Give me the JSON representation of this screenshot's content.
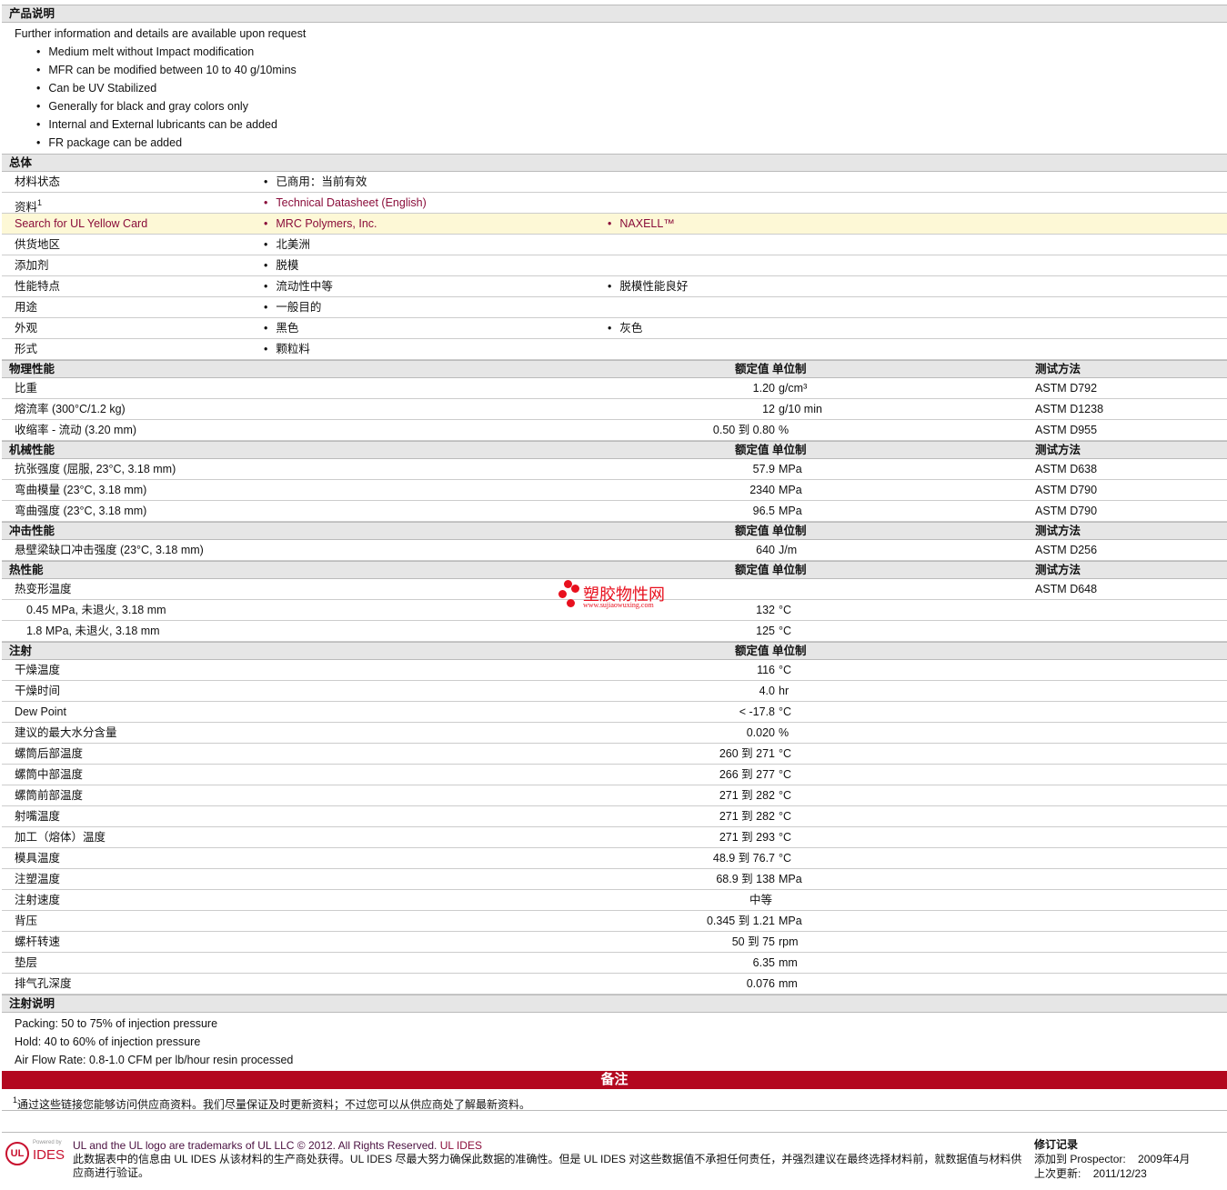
{
  "product_description": {
    "title": "产品说明",
    "intro": "Further information and details are available upon request",
    "bullets": [
      "Medium melt without Impact modification",
      "MFR can be modified between 10 to 40 g/10mins",
      "Can be UV Stabilized",
      "Generally for black and gray colors only",
      "Internal and External lubricants can be added",
      "FR package can be added"
    ]
  },
  "general": {
    "title": "总体",
    "rows": [
      {
        "label": "材料状态",
        "items": [
          "已商用：当前有效"
        ]
      },
      {
        "label": "资料",
        "sup": "1",
        "items": [
          "Technical Datasheet (English)"
        ],
        "links": true
      },
      {
        "label": "Search for UL Yellow Card",
        "items": [
          "MRC Polymers, Inc.",
          "NAXELL™"
        ],
        "links": true,
        "highlight": true
      },
      {
        "label": "供货地区",
        "items": [
          "北美洲"
        ]
      },
      {
        "label": "添加剂",
        "items": [
          "脱模"
        ]
      },
      {
        "label": "性能特点",
        "items": [
          "流动性中等",
          "脱模性能良好"
        ]
      },
      {
        "label": "用途",
        "items": [
          "一般目的"
        ]
      },
      {
        "label": "外观",
        "items": [
          "黑色",
          "灰色"
        ]
      },
      {
        "label": "形式",
        "items": [
          "颗粒料"
        ]
      }
    ]
  },
  "headers": {
    "value_unit": "额定值 单位制",
    "method": "测试方法"
  },
  "sections": [
    {
      "title": "物理性能",
      "method_col": true,
      "rows": [
        {
          "label": "比重",
          "value": "1.20",
          "unit": "g/cm³",
          "method": "ASTM D792"
        },
        {
          "label": "熔流率  (300°C/1.2 kg)",
          "value": "12",
          "unit": "g/10 min",
          "method": "ASTM D1238"
        },
        {
          "label": "收缩率  - 流动  (3.20 mm)",
          "value": "0.50 到  0.80",
          "unit": "%",
          "method": "ASTM D955"
        }
      ]
    },
    {
      "title": "机械性能",
      "method_col": true,
      "rows": [
        {
          "label": "抗张强度  (屈服, 23°C, 3.18 mm)",
          "value": "57.9",
          "unit": "MPa",
          "method": "ASTM D638"
        },
        {
          "label": "弯曲模量  (23°C, 3.18 mm)",
          "value": "2340",
          "unit": "MPa",
          "method": "ASTM D790"
        },
        {
          "label": "弯曲强度  (23°C, 3.18 mm)",
          "value": "96.5",
          "unit": "MPa",
          "method": "ASTM D790"
        }
      ]
    },
    {
      "title": "冲击性能",
      "method_col": true,
      "rows": [
        {
          "label": "悬壁梁缺口冲击强度  (23°C, 3.18 mm)",
          "value": "640",
          "unit": "J/m",
          "method": "ASTM D256"
        }
      ]
    },
    {
      "title": "热性能",
      "method_col": true,
      "rows": [
        {
          "label": "热变形温度",
          "value": "",
          "unit": "",
          "method": "ASTM D648"
        },
        {
          "label": "0.45 MPa, 未退火, 3.18 mm",
          "value": "132",
          "unit": "°C",
          "method": "",
          "indent": true
        },
        {
          "label": "1.8 MPa, 未退火, 3.18 mm",
          "value": "125",
          "unit": "°C",
          "method": "",
          "indent": true
        }
      ]
    },
    {
      "title": "注射",
      "method_col": false,
      "rows": [
        {
          "label": "干燥温度",
          "value": "116",
          "unit": "°C"
        },
        {
          "label": "干燥时间",
          "value": "4.0",
          "unit": "hr"
        },
        {
          "label": "Dew Point",
          "value": "< -17.8",
          "unit": "°C"
        },
        {
          "label": "建议的最大水分含量",
          "value": "0.020",
          "unit": "%"
        },
        {
          "label": "螺筒后部温度",
          "value": "260 到  271",
          "unit": "°C"
        },
        {
          "label": "螺筒中部温度",
          "value": "266 到  277",
          "unit": "°C"
        },
        {
          "label": "螺筒前部温度",
          "value": "271 到  282",
          "unit": "°C"
        },
        {
          "label": "射嘴温度",
          "value": "271 到  282",
          "unit": "°C"
        },
        {
          "label": "加工（熔体）温度",
          "value": "271 到  293",
          "unit": "°C"
        },
        {
          "label": "模具温度",
          "value": "48.9 到  76.7",
          "unit": "°C"
        },
        {
          "label": "注塑温度",
          "value": "68.9 到  138",
          "unit": "MPa"
        },
        {
          "label": "注射速度",
          "center": "中等"
        },
        {
          "label": "背压",
          "value": "0.345 到  1.21",
          "unit": "MPa"
        },
        {
          "label": "螺杆转速",
          "value": "50 到  75",
          "unit": "rpm"
        },
        {
          "label": "垫层",
          "value": "6.35",
          "unit": "mm"
        },
        {
          "label": "排气孔深度",
          "value": "0.076",
          "unit": "mm"
        }
      ]
    }
  ],
  "injection_notes": {
    "title": "注射说明",
    "lines": [
      "Packing: 50 to 75% of injection pressure",
      "Hold: 40 to 60% of injection pressure",
      "Air Flow Rate: 0.8-1.0 CFM per lb/hour resin processed"
    ]
  },
  "remarks": {
    "title": "备注",
    "footnote_num": "1",
    "footnote": "通过这些链接您能够访问供应商资料。我们尽量保证及时更新资料；不过您可以从供应商处了解最新资料。"
  },
  "watermark": {
    "name": "塑胶物性网",
    "url": "www.sujiaowuxing.com"
  },
  "footer": {
    "logo_ul": "UL",
    "logo_powered": "Powered by",
    "logo_ides": "IDES",
    "trademark": "UL and the UL logo are trademarks of UL LLC © 2012. All Rights Reserved.",
    "trademark_link": "UL IDES",
    "disclaimer": "此数据表中的信息由 UL IDES 从该材料的生产商处获得。UL IDES 尽最大努力确保此数据的准确性。但是 UL IDES 对这些数据值不承担任何责任，并强烈建议在最终选择材料前，就数据值与材料供应商进行验证。",
    "revision_title": "修订记录",
    "added_label": "添加到 Prospector:",
    "added_value": "2009年4月",
    "updated_label": "上次更新:",
    "updated_value": "2011/12/23"
  },
  "colors": {
    "header_bg": "#e6e6e6",
    "link": "#8a0d3a",
    "remarks_bar": "#b3081f",
    "highlight": "#fdf8d6"
  }
}
